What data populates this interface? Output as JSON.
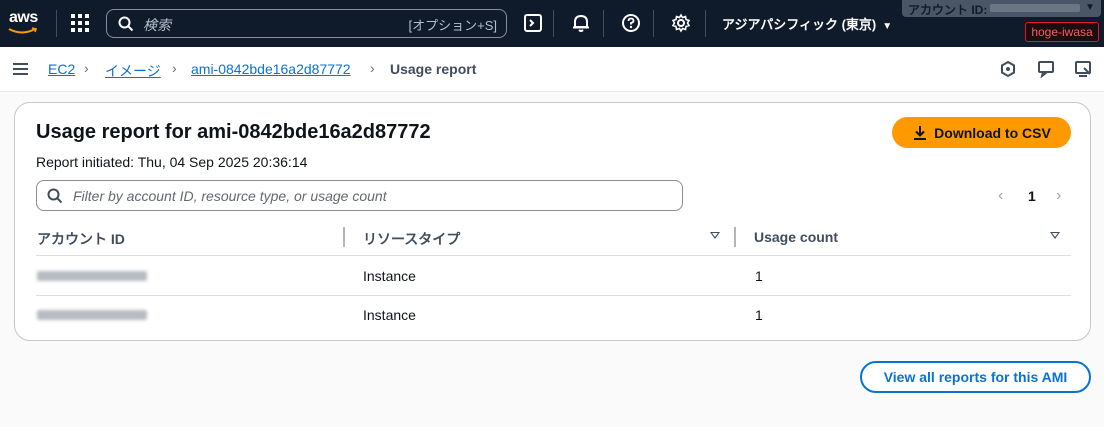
{
  "topnav": {
    "logo_text": "aws",
    "search_placeholder": "検索",
    "search_shortcut": "[オプション+S]",
    "region": "アジアパシフィック (東京)",
    "account_label": "アカウント ID:",
    "user": "hoge-iwasa",
    "icons": [
      "services-grid-icon",
      "search-icon",
      "cloudshell-icon",
      "bell-icon",
      "help-icon",
      "gear-icon"
    ]
  },
  "breadcrumb": {
    "items": [
      "EC2",
      "イメージ",
      "ami-0842bde16a2d87772",
      "Usage report"
    ]
  },
  "card": {
    "title": "Usage report for ami-0842bde16a2d87772",
    "subtitle": "Report initiated: Thu, 04 Sep 2025 20:36:14",
    "download_label": "Download to CSV",
    "filter_placeholder": "Filter by account ID, resource type, or usage count",
    "page_number": "1"
  },
  "table": {
    "columns": [
      "アカウント ID",
      "リソースタイプ",
      "Usage count"
    ],
    "rows": [
      {
        "resource_type": "Instance",
        "usage_count": "1"
      },
      {
        "resource_type": "Instance",
        "usage_count": "1"
      }
    ]
  },
  "footer": {
    "view_all_label": "View all reports for this AMI"
  },
  "colors": {
    "nav_bg": "#0f1b2a",
    "primary_button": "#ff9900",
    "link": "#0972d3"
  }
}
